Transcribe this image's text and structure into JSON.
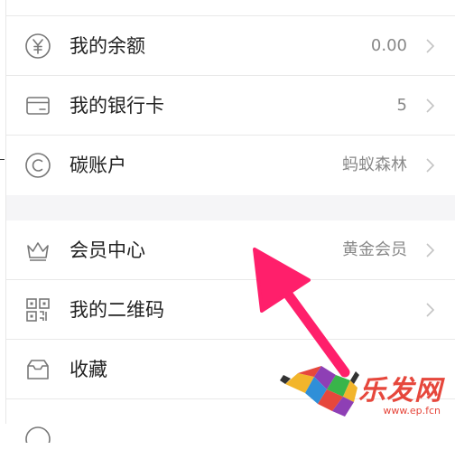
{
  "menu": {
    "balance": {
      "label": "我的余额",
      "value": "0.00",
      "icon": "yen-icon"
    },
    "bank_card": {
      "label": "我的银行卡",
      "value": "5",
      "icon": "card-icon"
    },
    "carbon": {
      "label": "碳账户",
      "value": "蚂蚁森林",
      "icon": "carbon-icon"
    },
    "member": {
      "label": "会员中心",
      "value": "黄金会员",
      "icon": "crown-icon"
    },
    "qrcode": {
      "label": "我的二维码",
      "value": "",
      "icon": "qr-code-icon"
    },
    "favorites": {
      "label": "收藏",
      "value": "",
      "icon": "favorites-box-icon"
    }
  },
  "watermark": {
    "brand": "乐发网",
    "url": "www.ep.fcn"
  },
  "colors": {
    "arrow": "#ff1f6b",
    "icon_stroke": "#777777",
    "value_text": "#888888",
    "watermark": "#e6473c"
  }
}
